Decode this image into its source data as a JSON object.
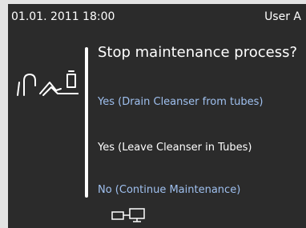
{
  "status_bar": {
    "datetime": "01.01. 2011 18:00",
    "user": "User A"
  },
  "dialog": {
    "question": "Stop maintenance process?",
    "options": [
      {
        "label": "Yes  (Drain Cleanser from tubes)",
        "color": "#9fc0ef"
      },
      {
        "label": "Yes  (Leave Cleanser in Tubes)",
        "color": "#ffffff"
      },
      {
        "label": "No  (Continue Maintenance)",
        "color": "#9fc0ef"
      }
    ],
    "side_icon": "maintenance-tubes-bottle-icon",
    "bottom_icon": "device-connection-icon"
  },
  "colors": {
    "background": "#2b2b2b",
    "accent": "#9fc0ef",
    "text": "#ffffff"
  }
}
